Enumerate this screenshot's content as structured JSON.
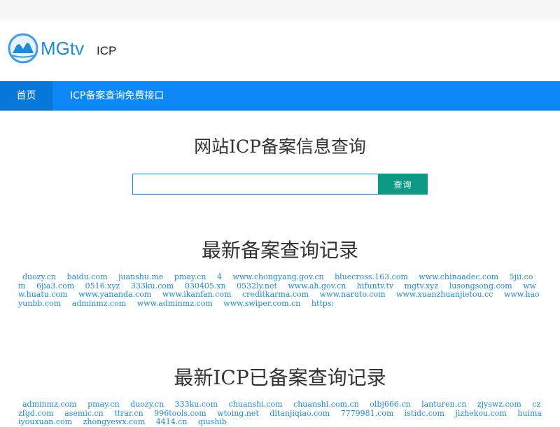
{
  "header": {
    "logo_text_m": "M",
    "logo_text_gtv": "Gtv",
    "logo_sub": "ICP"
  },
  "nav": {
    "home": "首页",
    "api": "ICP备案查询免费接口"
  },
  "search": {
    "title": "网站ICP备案信息查询",
    "value": "",
    "placeholder": "",
    "button": "查询"
  },
  "latest_queries": {
    "title": "最新备案查询记录",
    "links": [
      "duozy.cn",
      "baidu.com",
      "juanshu.me",
      "pmay.cn",
      "4",
      "www.chongyang.gov.cn",
      "bluecross.163.com",
      "www.chinaadec.com",
      "5jii.com",
      "6jia3.com",
      "0516.xyz",
      "333ku.com",
      "030405.xn",
      "0532ly.net",
      "www.ah.gov.cn",
      "hifuntv.tv",
      "mgtv.xyz",
      "lusongsong.com",
      "www.huatu.com",
      "www.yananda.com",
      "www.ikanfan.com",
      "creditkarma.com",
      "www.naruto.com",
      "www.xuanzhuanjietou.cc",
      "www.haoyunbb.com",
      "adminmz.com",
      "www.adminmz.com",
      "www.swiper.com.cn",
      "https:"
    ]
  },
  "latest_registered": {
    "title": "最新ICP已备案查询记录",
    "links": [
      "adminmz.com",
      "pmay.cn",
      "duozy.cn",
      "333ku.com",
      "chuanshi.com",
      "chuanshi.com.cn",
      "olbj666.cn",
      "lanturen.cn",
      "zjyswz.com",
      "czzfgd.com",
      "asemic.cn",
      "ttrar.cn",
      "996tools.com",
      "wtoing.net",
      "ditanjiqiao.com",
      "7779981.com",
      "istidc.com",
      "jizhekou.com",
      "huimaiyouxuan.com",
      "zhongyewx.com",
      "4414.cn",
      "qiushib"
    ]
  }
}
